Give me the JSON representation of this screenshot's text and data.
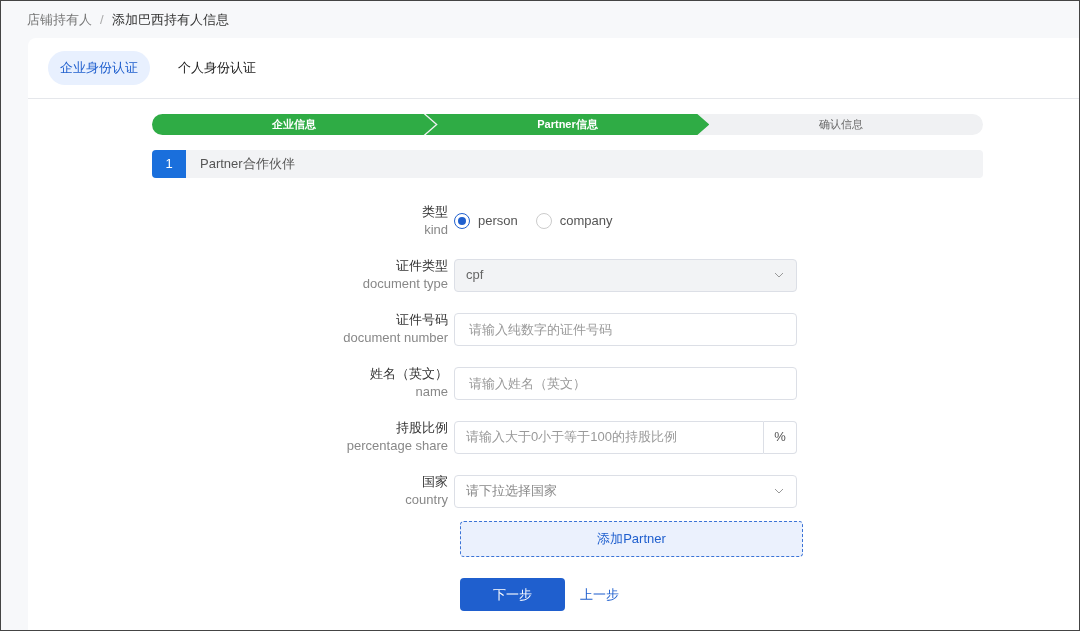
{
  "breadcrumb": [
    "店铺持有人",
    "添加巴西持有人信息"
  ],
  "breadcrumb_separator": "/",
  "tabs": [
    {
      "label": "企业身份认证",
      "selected": true
    },
    {
      "label": "个人身份认证",
      "selected": false
    }
  ],
  "steps": [
    {
      "label": "企业信息",
      "completed": true
    },
    {
      "label": "Partner信息",
      "completed": true
    },
    {
      "label": "确认信息",
      "completed": false
    }
  ],
  "section": {
    "number": "1",
    "title": "Partner合作伙伴"
  },
  "fields": [
    {
      "kind": "radio",
      "label": "类型",
      "sublabel": "kind",
      "options": [
        {
          "label": "person",
          "selected": true
        },
        {
          "label": "company",
          "selected": false
        }
      ]
    },
    {
      "kind": "select",
      "label": "证件类型",
      "sublabel": "document type",
      "value": "cpf",
      "disabled": true
    },
    {
      "kind": "input",
      "label": "证件号码",
      "sublabel": "document number",
      "placeholder": "请输入纯数字的证件号码"
    },
    {
      "kind": "input",
      "label": "姓名（英文）",
      "sublabel": "name",
      "placeholder": "请输入姓名（英文）"
    },
    {
      "kind": "input_suffix",
      "label": "持股比例",
      "sublabel": "percentage share",
      "placeholder": "请输入大于0小于等于100的持股比例",
      "suffix": "%"
    },
    {
      "kind": "select",
      "label": "国家",
      "sublabel": "country",
      "placeholder": "请下拉选择国家",
      "disabled": false
    }
  ],
  "add_button": "添加Partner",
  "next_button": "下一步",
  "prev_link": "上一步"
}
